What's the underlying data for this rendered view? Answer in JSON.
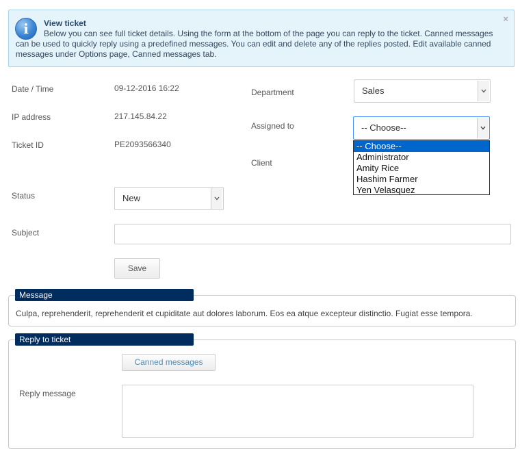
{
  "info": {
    "title": "View ticket",
    "text": "Below you can see full ticket details. Using the form at the bottom of the page you can reply to the ticket. Canned messages can be used to quickly reply using a predefined messages. You can edit and delete any of the replies posted. Edit available canned messages under Options page, Canned messages tab.",
    "close": "×"
  },
  "details": {
    "date_label": "Date / Time",
    "date_value": "09-12-2016 16:22",
    "ip_label": "IP address",
    "ip_value": "217.145.84.22",
    "ticket_label": "Ticket ID",
    "ticket_value": "PE2093566340",
    "status_label": "Status",
    "status_value": "New",
    "subject_label": "Subject",
    "subject_value": "",
    "save_label": "Save"
  },
  "assign": {
    "department_label": "Department",
    "department_value": "Sales",
    "assigned_label": "Assigned to",
    "assigned_value": "-- Choose--",
    "client_label": "Client",
    "options": [
      "-- Choose--",
      "Administrator",
      "Amity Rice",
      "Hashim Farmer",
      "Yen Velasquez"
    ]
  },
  "message": {
    "header": "Message",
    "body": "Culpa, reprehenderit, reprehenderit et cupiditate aut dolores laborum. Eos ea atque excepteur distinctio. Fugiat esse tempora."
  },
  "reply": {
    "header": "Reply to ticket",
    "canned_label": "Canned messages",
    "reply_label": "Reply message",
    "reply_value": ""
  },
  "colors": {
    "panel_header": "#002c5e",
    "info_bg": "#e5f3fb",
    "selected_option": "#0066cc"
  }
}
